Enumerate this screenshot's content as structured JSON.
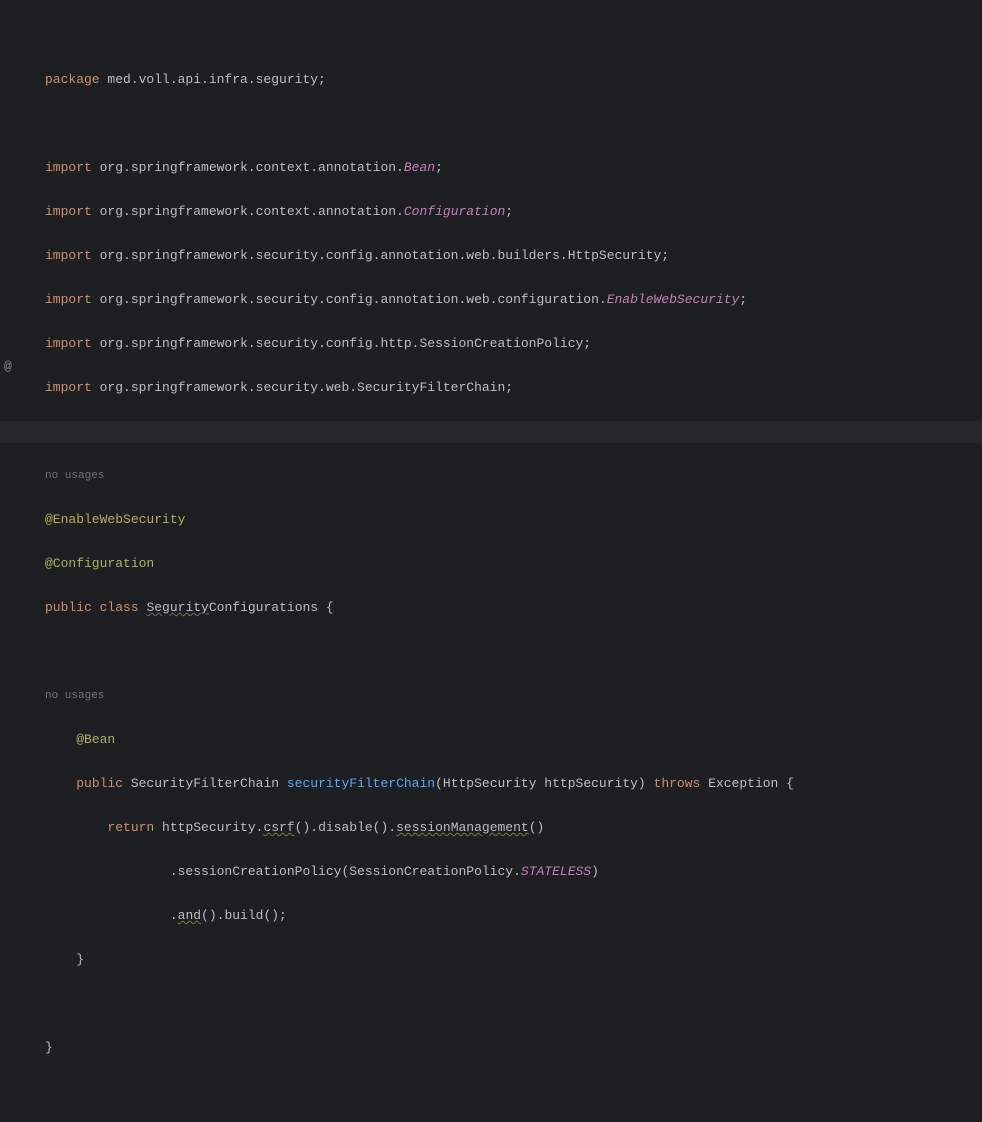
{
  "gutter": {
    "icon": "@"
  },
  "code": {
    "l1": {
      "kw": "package",
      "rest": " med.voll.api.infra.segurity;"
    },
    "l2": "",
    "l3": {
      "kw": "import",
      "p1": " org.springframework.context.annotation.",
      "cls": "Bean",
      "p2": ";"
    },
    "l4": {
      "kw": "import",
      "p1": " org.springframework.context.annotation.",
      "cls": "Configuration",
      "p2": ";"
    },
    "l5": {
      "kw": "import",
      "rest": " org.springframework.security.config.annotation.web.builders.HttpSecurity;"
    },
    "l6": {
      "kw": "import",
      "p1": " org.springframework.security.config.annotation.web.configuration.",
      "cls": "EnableWebSecurity",
      "p2": ";"
    },
    "l7": {
      "kw": "import",
      "rest": " org.springframework.security.config.http.SessionCreationPolicy;"
    },
    "l8": {
      "kw": "import",
      "rest": " org.springframework.security.web.SecurityFilterChain;"
    },
    "hint1": "no usages",
    "l10": "@EnableWebSecurity",
    "l11": "@Configuration",
    "l12": {
      "kw1": "public",
      "kw2": "class",
      "w1": "Segurity",
      "w2": "Configurations",
      "brace": " {"
    },
    "hint2": "no usages",
    "l14": "@Bean",
    "l15": {
      "kw": "public",
      "type": " SecurityFilterChain ",
      "mtd": "securityFilterChain",
      "sig1": "(HttpSecurity httpSecurity) ",
      "kw2": "throws",
      "sig2": " Exception {"
    },
    "l16": {
      "kw": "return",
      "p1": " httpSecurity.",
      "w1": "csrf",
      "p2": "().disable().",
      "w2": "sessionManagement",
      "p3": "()"
    },
    "l17": {
      "p1": ".sessionCreationPolicy(SessionCreationPolicy.",
      "enum": "STATELESS",
      "p2": ")"
    },
    "l18": {
      "p1": ".",
      "w1": "and",
      "p2": "().build();"
    },
    "l19": "}",
    "l20": "}"
  }
}
